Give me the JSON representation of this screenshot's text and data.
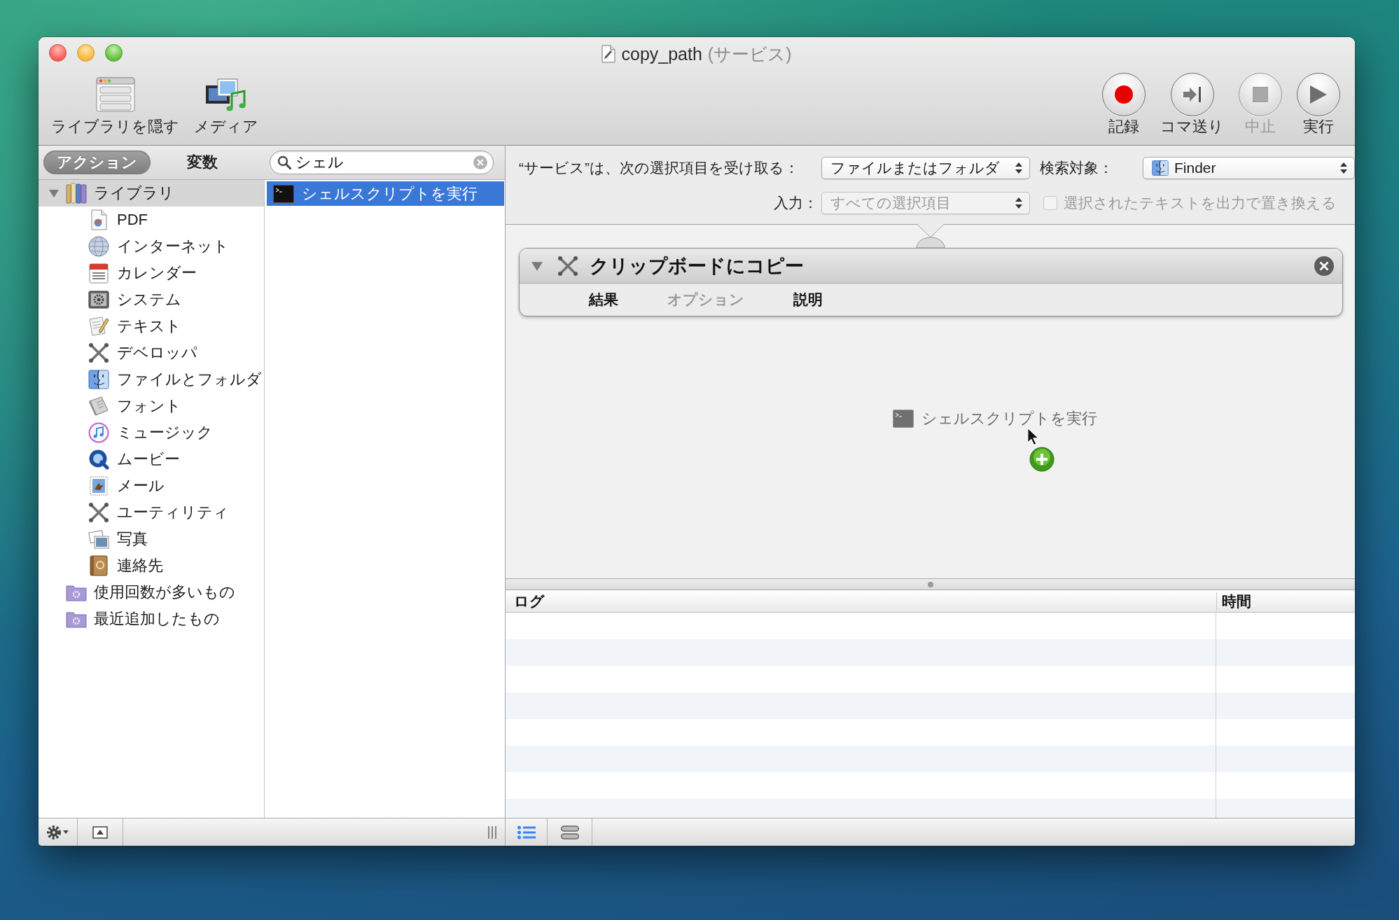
{
  "window": {
    "title": "copy_path",
    "subtitle": "(サービス)"
  },
  "toolbar": {
    "left": [
      {
        "kind": "library",
        "label": "ライブラリを隠す"
      },
      {
        "kind": "media",
        "label": "メディア"
      }
    ],
    "right": [
      {
        "kind": "record",
        "label": "記録",
        "disabled": false
      },
      {
        "kind": "step",
        "label": "コマ送り",
        "disabled": false
      },
      {
        "kind": "stop",
        "label": "中止",
        "disabled": true
      },
      {
        "kind": "run",
        "label": "実行",
        "disabled": false
      }
    ]
  },
  "library_tabs": [
    {
      "label": "アクション",
      "selected": true
    },
    {
      "label": "変数",
      "selected": false
    }
  ],
  "search": {
    "value": "シェル"
  },
  "library_tree": [
    {
      "kind": "library",
      "label": "ライブラリ",
      "expanded": true,
      "selected": true,
      "children": [
        {
          "kind": "pdf",
          "label": "PDF",
          "selected": false
        },
        {
          "kind": "internet",
          "label": "インターネット",
          "selected": false
        },
        {
          "kind": "calendar",
          "label": "カレンダー",
          "selected": false
        },
        {
          "kind": "system",
          "label": "システム",
          "selected": false
        },
        {
          "kind": "text",
          "label": "テキスト",
          "selected": false
        },
        {
          "kind": "developer",
          "label": "デベロッパ",
          "selected": false
        },
        {
          "kind": "files",
          "label": "ファイルとフォルダ",
          "selected": false
        },
        {
          "kind": "fonts",
          "label": "フォント",
          "selected": false
        },
        {
          "kind": "music",
          "label": "ミュージック",
          "selected": false
        },
        {
          "kind": "movies",
          "label": "ムービー",
          "selected": false
        },
        {
          "kind": "mail",
          "label": "メール",
          "selected": false
        },
        {
          "kind": "utilities",
          "label": "ユーティリティ",
          "selected": false
        },
        {
          "kind": "photos",
          "label": "写真",
          "selected": false
        },
        {
          "kind": "contacts",
          "label": "連絡先",
          "selected": false
        }
      ]
    },
    {
      "kind": "smart-folder",
      "label": "使用回数が多いもの",
      "selected": false
    },
    {
      "kind": "smart-folder",
      "label": "最近追加したもの",
      "selected": false
    }
  ],
  "actions": [
    {
      "label": "シェルスクリプトを実行",
      "selected": true
    }
  ],
  "workflow": {
    "receives_label": "“サービス”は、次の選択項目を受け取る：",
    "receives_value": "ファイルまたはフォルダ",
    "target_label": "検索対象：",
    "target_value": "Finder",
    "input_label": "入力：",
    "input_value": "すべての選択項目",
    "input_disabled": true,
    "replace_label": "選択されたテキストを出力で置き換える",
    "replace_checked": false,
    "replace_disabled": true
  },
  "action_card": {
    "title": "クリップボードにコピー",
    "expanded": true,
    "tabs": [
      {
        "label": "結果",
        "disabled": false
      },
      {
        "label": "オプション",
        "disabled": true
      },
      {
        "label": "説明",
        "disabled": false
      }
    ]
  },
  "dragged_action": {
    "label": "シェルスクリプトを実行"
  },
  "log": {
    "columns": [
      "ログ",
      "時間"
    ]
  },
  "bottom_bar": {
    "view_modes": [
      {
        "kind": "list",
        "selected": true
      },
      {
        "kind": "workflow",
        "selected": false
      }
    ]
  }
}
